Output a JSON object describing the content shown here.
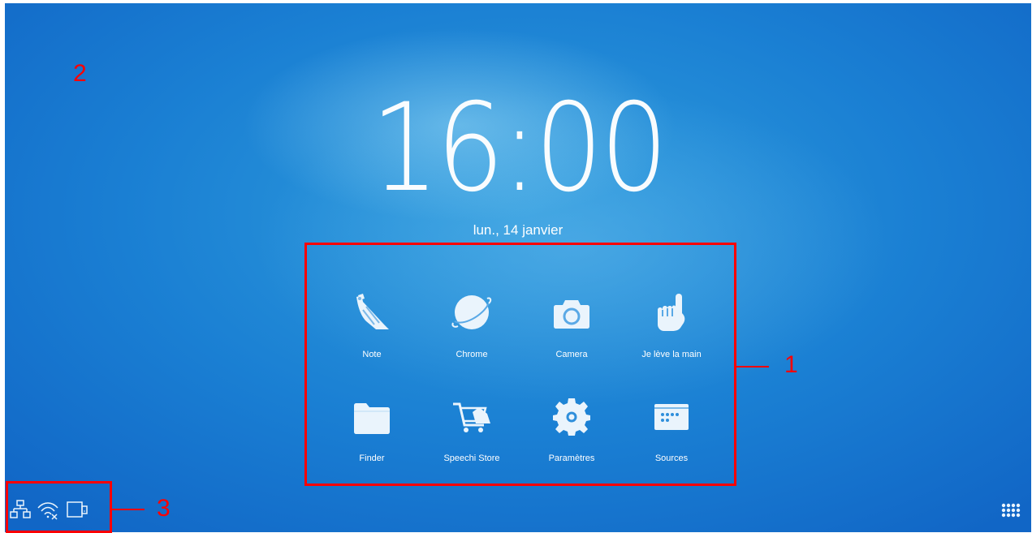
{
  "home": {
    "time": "16:00",
    "date": "lun., 14 janvier"
  },
  "apps": [
    {
      "label": "Note",
      "icon": "note-pen-icon"
    },
    {
      "label": "Chrome",
      "icon": "planet-browser-icon"
    },
    {
      "label": "Camera",
      "icon": "camera-icon"
    },
    {
      "label": "Je lève la main",
      "icon": "raised-hand-icon"
    },
    {
      "label": "Finder",
      "icon": "folder-icon"
    },
    {
      "label": "Speechi Store",
      "icon": "shopping-cart-icon"
    },
    {
      "label": "Paramètres",
      "icon": "gear-icon"
    },
    {
      "label": "Sources",
      "icon": "input-sources-icon"
    }
  ],
  "status_bar": {
    "icons": [
      "ethernet-network-icon",
      "wifi-disconnected-icon",
      "screen-cast-icon"
    ]
  },
  "launcher_icon": "app-grid-icon",
  "annotations": {
    "label_1": "1",
    "label_2": "2",
    "label_3": "3",
    "color": "#ff0000"
  },
  "colors": {
    "background": "#1a7fd3",
    "icon": "#eaf4fc",
    "text": "#ffffff"
  }
}
